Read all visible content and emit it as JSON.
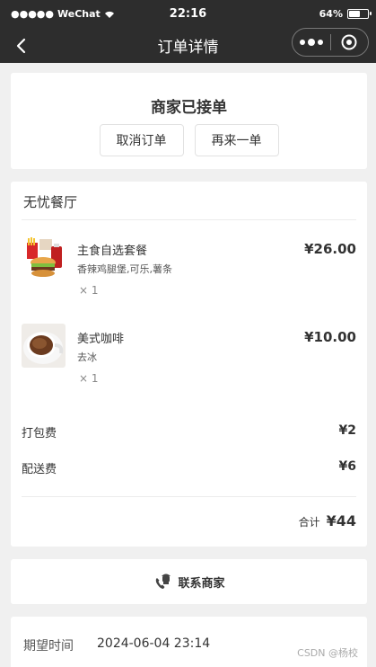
{
  "status_bar": {
    "signal": "●●●●●",
    "carrier": "WeChat",
    "time": "22:16",
    "battery_text": "64%",
    "battery_level": 0.64
  },
  "nav": {
    "title": "订单详情"
  },
  "order_status": {
    "title": "商家已接单",
    "cancel_label": "取消订单",
    "reorder_label": "再来一单"
  },
  "shop": {
    "name": "无忧餐厅"
  },
  "items": [
    {
      "name": "主食自选套餐",
      "desc": "香辣鸡腿堡,可乐,薯条",
      "qty": "× 1",
      "price": "¥26.00",
      "icon": "burger-combo-image"
    },
    {
      "name": "美式咖啡",
      "desc": "去冰",
      "qty": "× 1",
      "price": "¥10.00",
      "icon": "coffee-image"
    }
  ],
  "fees": [
    {
      "label": "打包费",
      "value": "¥2"
    },
    {
      "label": "配送费",
      "value": "¥6"
    }
  ],
  "total": {
    "label": "合计",
    "value": "¥44"
  },
  "contact": {
    "label": "联系商家",
    "icon": "merchant-phone-icon"
  },
  "delivery": {
    "label": "期望时间",
    "value": "2024-06-04 23:14"
  },
  "watermark": "CSDN @杨校"
}
